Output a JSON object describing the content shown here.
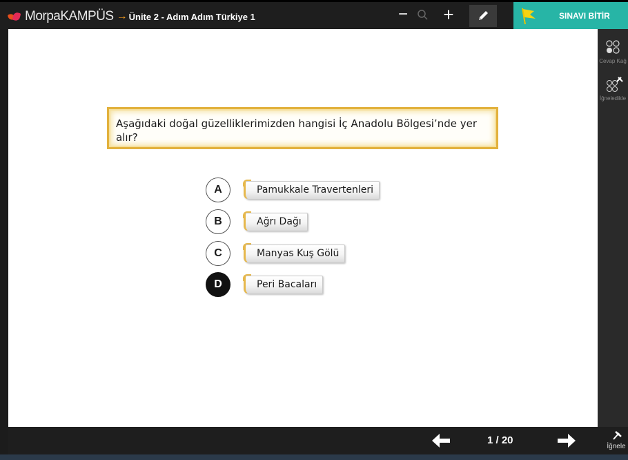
{
  "topbar": {
    "app_name": "MorpaKAMPÜS",
    "arrow": "→",
    "unit_title": "Ünite 2 - Adım Adım Türkiye 1",
    "zoom_out_icon": "minus-icon",
    "zoom_icon": "magnifier-icon",
    "zoom_in_icon": "plus-icon",
    "pen_icon": "pencil-icon",
    "finish_label": "SINAVI BİTİR",
    "finish_icon": "flag-icon",
    "accent_color": "#27b5a6"
  },
  "question": {
    "text": "Aşağıdaki doğal güzelliklerimizden hangisi İç Anadolu Bölgesi’nde yer alır?"
  },
  "options": [
    {
      "letter": "A",
      "text": "Pamukkale Travertenleri",
      "selected": false
    },
    {
      "letter": "B",
      "text": "Ağrı Dağı",
      "selected": false
    },
    {
      "letter": "C",
      "text": "Manyas Kuş Gölü",
      "selected": false
    },
    {
      "letter": "D",
      "text": "Peri Bacaları",
      "selected": true
    }
  ],
  "right_panel": {
    "answer_key_label": "Cevap Kağ",
    "pinned_label": "İğneledikle"
  },
  "bottombar": {
    "prev_icon": "arrow-left-icon",
    "page": "1 / 20",
    "next_icon": "arrow-right-icon",
    "pin_label": "İğnele",
    "pin_icon": "pin-icon"
  }
}
